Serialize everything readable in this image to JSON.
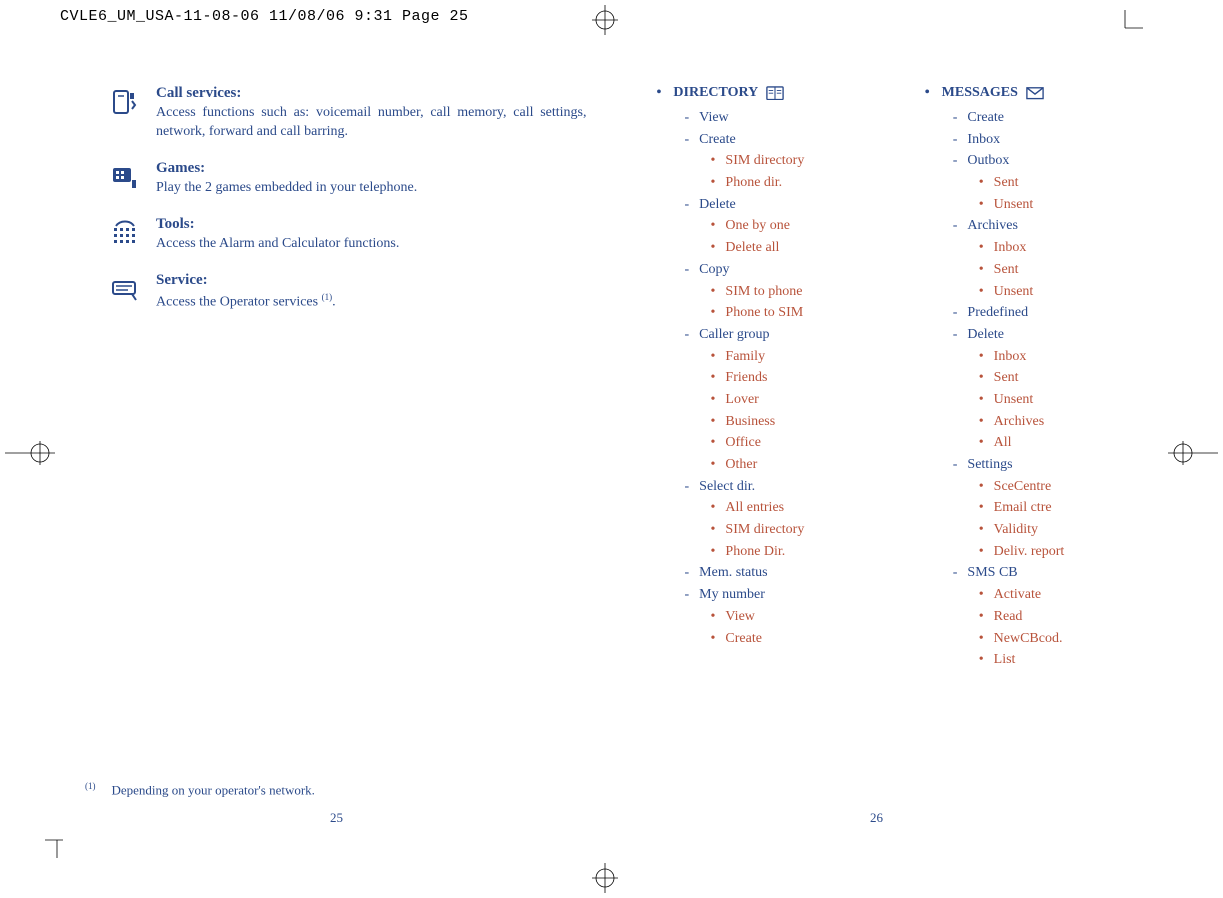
{
  "print_header": "CVLE6_UM_USA-11-08-06  11/08/06  9:31  Page 25",
  "left": {
    "features": [
      {
        "title": "Call services:",
        "desc": "Access functions such as: voicemail number, call memory, call settings, network, forward and call barring.",
        "icon": "call-services-icon"
      },
      {
        "title": "Games:",
        "desc": "Play the 2 games embedded in your telephone.",
        "icon": "games-icon"
      },
      {
        "title": "Tools:",
        "desc": "Access the Alarm and Calculator functions.",
        "icon": "tools-icon"
      },
      {
        "title": "Service:",
        "desc_pre": "Access the Operator services ",
        "desc_sup": "(1)",
        "desc_post": ".",
        "icon": "service-icon"
      }
    ],
    "footnote_mark": "(1)",
    "footnote_text": "Depending on your operator's network.",
    "page_num": "25"
  },
  "right": {
    "directory": {
      "heading": "DIRECTORY",
      "items": [
        {
          "label": "View"
        },
        {
          "label": "Create",
          "sub": [
            "SIM directory",
            "Phone dir."
          ]
        },
        {
          "label": "Delete",
          "sub": [
            "One by one",
            "Delete all"
          ]
        },
        {
          "label": "Copy",
          "sub": [
            "SIM to phone",
            "Phone to SIM"
          ]
        },
        {
          "label": "Caller group",
          "sub": [
            "Family",
            "Friends",
            "Lover",
            "Business",
            "Office",
            "Other"
          ]
        },
        {
          "label": "Select dir.",
          "sub": [
            "All entries",
            "SIM directory",
            "Phone Dir."
          ]
        },
        {
          "label": "Mem. status"
        },
        {
          "label": "My number",
          "sub": [
            "View",
            "Create"
          ]
        }
      ]
    },
    "messages": {
      "heading": "MESSAGES",
      "items": [
        {
          "label": "Create"
        },
        {
          "label": "Inbox"
        },
        {
          "label": "Outbox",
          "sub": [
            "Sent",
            "Unsent"
          ]
        },
        {
          "label": "Archives",
          "sub": [
            "Inbox",
            "Sent",
            "Unsent"
          ]
        },
        {
          "label": "Predefined"
        },
        {
          "label": "Delete",
          "sub": [
            "Inbox",
            "Sent",
            "Unsent",
            "Archives",
            "All"
          ]
        },
        {
          "label": "Settings",
          "sub": [
            "SceCentre",
            "Email ctre",
            "Validity",
            "Deliv. report"
          ]
        },
        {
          "label": "SMS CB",
          "sub": [
            "Activate",
            "Read",
            "NewCBcod.",
            "List"
          ]
        }
      ]
    },
    "page_num": "26"
  }
}
